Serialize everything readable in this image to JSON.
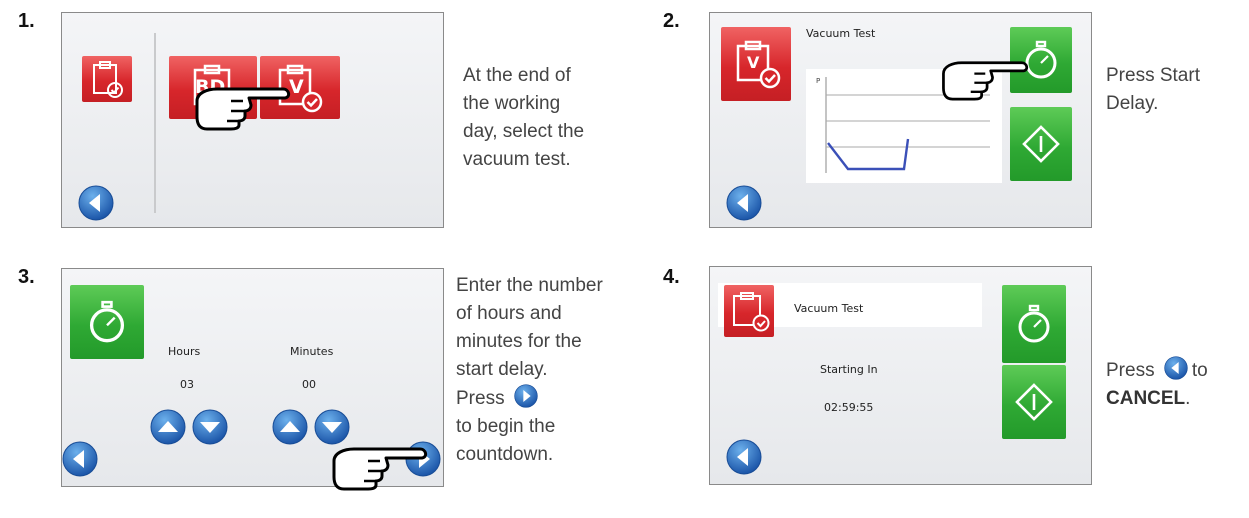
{
  "steps": [
    {
      "number": "1.",
      "description": [
        "At the end of",
        "the working",
        "day, select the",
        "vacuum test."
      ],
      "screen": {
        "button_bd": "BD",
        "button_v": "V"
      }
    },
    {
      "number": "2.",
      "description": [
        "Press Start",
        "Delay."
      ],
      "screen": {
        "title": "Vacuum Test",
        "chart_label": "P"
      }
    },
    {
      "number": "3.",
      "description": [
        "Enter the number",
        "of hours and",
        "minutes for the",
        "start delay."
      ],
      "description_press": "Press",
      "description_after": [
        "to begin the",
        "countdown."
      ],
      "screen": {
        "hours_label": "Hours",
        "minutes_label": "Minutes",
        "hours_value": "03",
        "minutes_value": "00"
      }
    },
    {
      "number": "4.",
      "description_press": "Press",
      "description_to": "to",
      "description_cancel": "CANCEL",
      "description_period": ".",
      "screen": {
        "title": "Vacuum Test",
        "starting_label": "Starting In",
        "countdown": "02:59:55"
      }
    }
  ],
  "icons": {
    "back": "back-arrow-icon",
    "next": "forward-arrow-icon",
    "timer": "stopwatch-icon",
    "start": "start-diamond-icon",
    "hand": "pointing-hand-icon",
    "clipboard": "clipboard-check-icon",
    "up": "up-arrow-icon",
    "down": "down-arrow-icon"
  },
  "colors": {
    "red_button": "#d7262b",
    "green_button": "#2fa934",
    "blue_circle": "#1f62b8",
    "text": "#444444"
  }
}
